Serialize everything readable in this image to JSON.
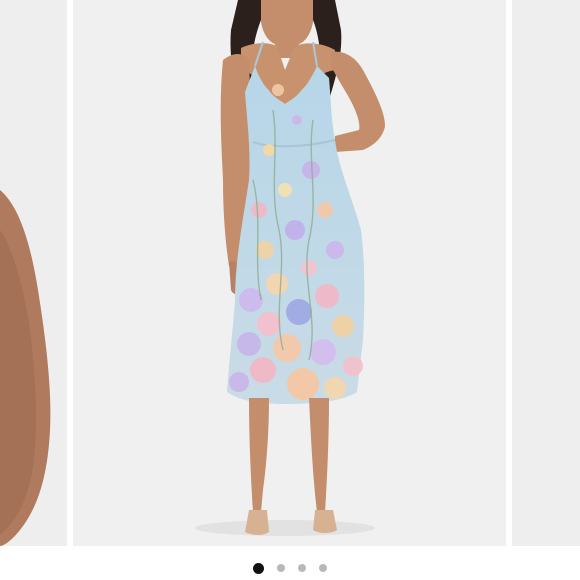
{
  "carousel": {
    "slide_count": 4,
    "active_index": 0,
    "slides": [
      {
        "name": "product-photo-1"
      },
      {
        "name": "product-photo-2"
      },
      {
        "name": "product-photo-3"
      },
      {
        "name": "product-photo-4"
      }
    ]
  },
  "zoom_button": {
    "icon": "search-icon"
  },
  "colors": {
    "background": "#ffffff",
    "slide_background": "#eeeeef",
    "zoom_button_bg": "#000000",
    "dot_active": "#111111",
    "dot_inactive": "#b8b8b8",
    "dress_base": "#b9d6e6"
  }
}
